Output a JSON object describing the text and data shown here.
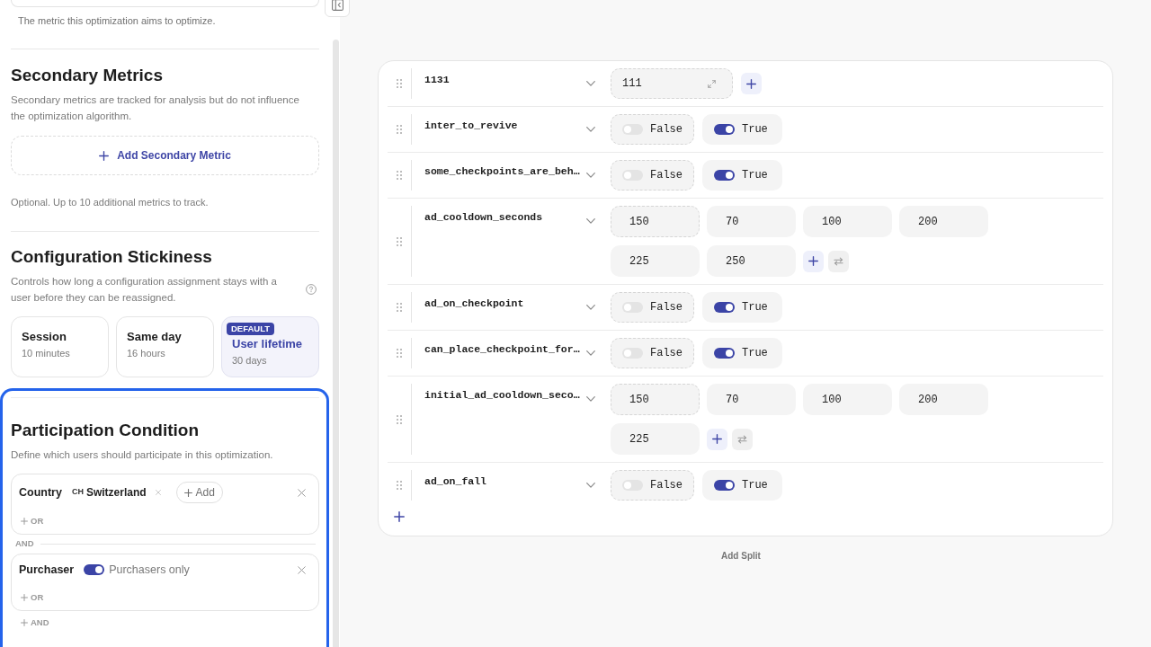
{
  "sidebar": {
    "primary_metric": {
      "hint": "The metric this optimization aims to optimize."
    },
    "secondary_metrics": {
      "title": "Secondary Metrics",
      "description": "Secondary metrics are tracked for analysis but do not influence the optimization algorithm.",
      "add_button": "Add Secondary Metric",
      "hint": "Optional. Up to 10 additional metrics to track."
    },
    "stickiness": {
      "title": "Configuration Stickiness",
      "description": "Controls how long a configuration assignment stays with a user before they can be reassigned.",
      "options": [
        {
          "label": "Session",
          "detail": "10 minutes",
          "selected": false
        },
        {
          "label": "Same day",
          "detail": "16 hours",
          "selected": false
        },
        {
          "label": "User lifetime",
          "detail": "30 days",
          "badge": "DEFAULT",
          "selected": true
        }
      ]
    },
    "participation": {
      "focused": true,
      "title": "Participation Condition",
      "description": "Define which users should participate in this optimization.",
      "conditions": [
        {
          "kind": "values",
          "field": "Country",
          "values": [
            {
              "code": "CH",
              "name": "Switzerland"
            }
          ],
          "add_label": "Add",
          "or_label": "OR"
        },
        {
          "kind": "toggle",
          "field": "Purchaser",
          "on": true,
          "label": "Purchasers only",
          "or_label": "OR"
        }
      ],
      "joiner": "AND",
      "add_and_label": "AND"
    }
  },
  "splits": {
    "parameters": [
      {
        "name": "1131",
        "kind": "text",
        "value": "111",
        "baseline": true
      },
      {
        "name": "inter_to_revive",
        "kind": "boolean",
        "options": [
          {
            "label": "False",
            "on": false,
            "baseline": true
          },
          {
            "label": "True",
            "on": true,
            "baseline": false
          }
        ]
      },
      {
        "name": "some_checkpoints_are_beh…",
        "kind": "boolean",
        "options": [
          {
            "label": "False",
            "on": false,
            "baseline": true
          },
          {
            "label": "True",
            "on": true,
            "baseline": false
          }
        ]
      },
      {
        "name": "ad_cooldown_seconds",
        "kind": "number_list",
        "values": [
          {
            "value": "150",
            "baseline": true
          },
          {
            "value": "70",
            "baseline": false
          },
          {
            "value": "100",
            "baseline": false
          },
          {
            "value": "200",
            "baseline": false
          },
          {
            "value": "225",
            "baseline": false
          },
          {
            "value": "250",
            "baseline": false
          }
        ]
      },
      {
        "name": "ad_on_checkpoint",
        "kind": "boolean",
        "options": [
          {
            "label": "False",
            "on": false,
            "baseline": true
          },
          {
            "label": "True",
            "on": true,
            "baseline": false
          }
        ]
      },
      {
        "name": "can_place_checkpoint_for…",
        "kind": "boolean",
        "options": [
          {
            "label": "False",
            "on": false,
            "baseline": true
          },
          {
            "label": "True",
            "on": true,
            "baseline": false
          }
        ]
      },
      {
        "name": "initial_ad_cooldown_seco…",
        "kind": "number_list",
        "values": [
          {
            "value": "150",
            "baseline": true
          },
          {
            "value": "70",
            "baseline": false
          },
          {
            "value": "100",
            "baseline": false
          },
          {
            "value": "200",
            "baseline": false
          },
          {
            "value": "225",
            "baseline": false
          }
        ]
      },
      {
        "name": "ad_on_fall",
        "kind": "boolean",
        "options": [
          {
            "label": "False",
            "on": false,
            "baseline": true
          },
          {
            "label": "True",
            "on": true,
            "baseline": false
          }
        ]
      }
    ],
    "add_split_label": "Add Split"
  }
}
